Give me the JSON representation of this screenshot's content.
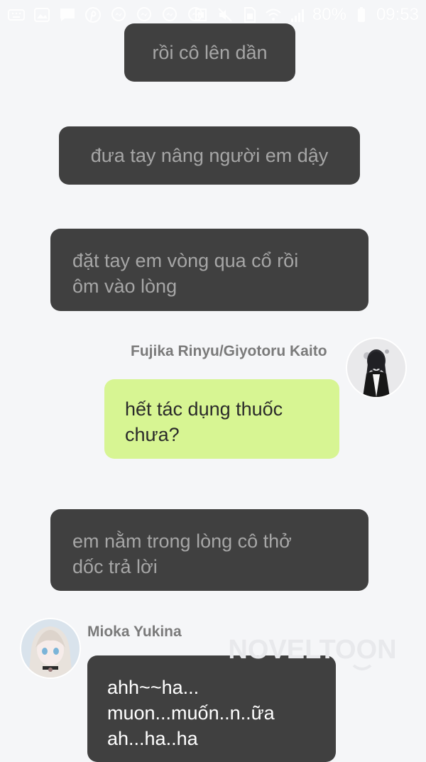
{
  "status_bar": {
    "battery": "80%",
    "time": "09:53",
    "icons": [
      "keyboard-icon",
      "photo-icon",
      "message-icon",
      "pinterest-icon",
      "messenger-icon",
      "messenger-icon",
      "messenger-icon",
      "messenger-icon",
      "nfc-icon",
      "mute-icon",
      "sim-icon",
      "wifi-icon",
      "signal-icon",
      "battery-icon"
    ]
  },
  "messages": [
    {
      "type": "narration",
      "text": "rồi cô lên dần"
    },
    {
      "type": "narration",
      "text": "đưa tay nâng người em dậy"
    },
    {
      "type": "narration",
      "text": "đặt tay em vòng qua cổ rồi\nôm vào lòng"
    },
    {
      "type": "chat",
      "sender": "Fujika Rinyu/Giyotoru Kaito",
      "side": "right",
      "text": "hết tác dụng thuốc\nchưa?"
    },
    {
      "type": "narration",
      "text": "em nằm trong lòng cô thở\ndốc trả lời"
    },
    {
      "type": "chat",
      "sender": "Mioka Yukina",
      "side": "left",
      "text": "ahh~~ha...\nmuon...muốn..n..ữa\nah...ha..ha"
    }
  ],
  "watermark": "NOVELTOON",
  "colors": {
    "background": "#f5f6f8",
    "narration_bg": "#404040",
    "narration_text": "#a6a6a6",
    "bubble_right_bg": "#d7f593",
    "bubble_left_bg": "#404040",
    "sender_name": "#7a7a7a"
  }
}
